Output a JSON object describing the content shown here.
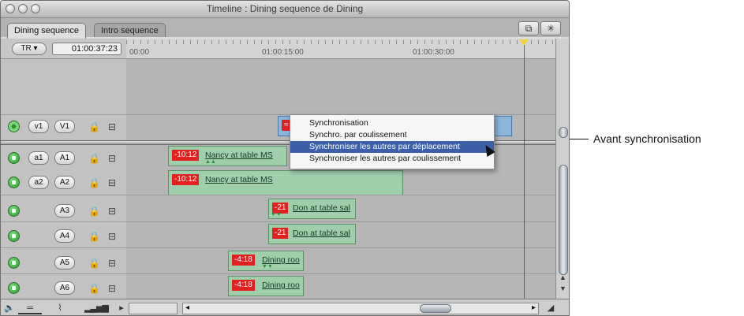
{
  "window": {
    "title": "Timeline : Dining sequence de Dining"
  },
  "tabs": [
    {
      "label": "Dining sequence",
      "active": true
    },
    {
      "label": "Intro sequence",
      "active": false
    }
  ],
  "toolbar": {
    "snap_icon": "snapping-icon",
    "linking_icon": "linking-icon"
  },
  "controls": {
    "tr_label": "TR ▾",
    "timecode": "01:00:37:23"
  },
  "ruler": {
    "labels": [
      "00:00",
      "01:00:15:00",
      "01:00:30:00"
    ]
  },
  "tracks": {
    "video": [
      {
        "source": "v1",
        "dest": "V1"
      }
    ],
    "audio": [
      {
        "source": "a1",
        "dest": "A1"
      },
      {
        "source": "a2",
        "dest": "A2"
      },
      {
        "source": "",
        "dest": "A3"
      },
      {
        "source": "",
        "dest": "A4"
      },
      {
        "source": "",
        "dest": "A5"
      },
      {
        "source": "",
        "dest": "A6"
      }
    ]
  },
  "clips": {
    "a1": {
      "offset": "-10:12",
      "name": "Nancy at table MS"
    },
    "a2": {
      "offset": "-10:12",
      "name": "Nancy at table MS"
    },
    "a3": {
      "offset": "-21",
      "name": "Don at table sal"
    },
    "a4": {
      "offset": "-21",
      "name": "Don at table sal"
    },
    "a5": {
      "offset": "-4:18",
      "name": "Dining roo"
    },
    "a6": {
      "offset": "-4:18",
      "name": "Dining roo"
    },
    "v1": {
      "offset": "≈"
    }
  },
  "context_menu": {
    "items": [
      {
        "label": "Synchronisation",
        "highlighted": false
      },
      {
        "label": "Synchro. par coulissement",
        "highlighted": false
      },
      {
        "label": "Synchroniser les autres par déplacement",
        "highlighted": true
      },
      {
        "label": "Synchroniser les autres par coulissement",
        "highlighted": false
      }
    ]
  },
  "callout": {
    "text": "Avant synchronisation"
  },
  "colors": {
    "clip_audio": "#9fcfaa",
    "clip_video": "#8ab6dc",
    "offset_badge": "#e22020",
    "menu_highlight": "#3d5fa8"
  }
}
